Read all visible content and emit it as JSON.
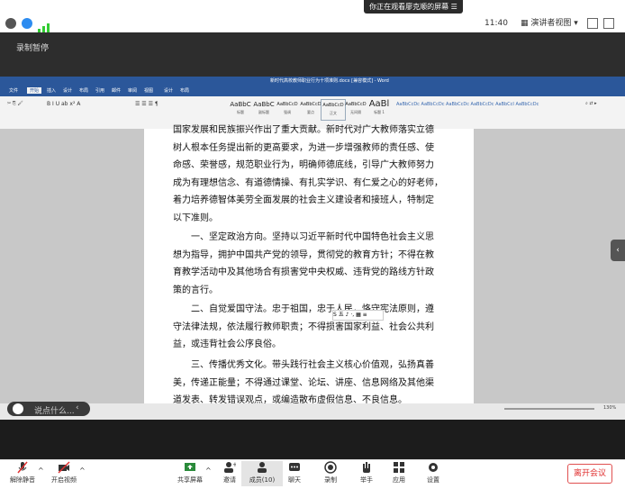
{
  "topbar": {
    "share_banner": "你正在观看廖克顺的屏幕",
    "time": "11:40",
    "view_label": "演讲者视图"
  },
  "recording": {
    "label": "录制暂停"
  },
  "word": {
    "title": "新时代高校教师职业行为十项准则.docx [兼容模式] - Word",
    "tabs": [
      "文件",
      "开始",
      "插入",
      "设计",
      "布局",
      "引用",
      "邮件",
      "审阅",
      "视图",
      "设计",
      "布局"
    ],
    "styles": [
      {
        "sample": "AaBbC",
        "name": "标题"
      },
      {
        "sample": "AaBbC",
        "name": "副标题"
      },
      {
        "sample": "AaBbCcD",
        "name": "强调"
      },
      {
        "sample": "AaBbCcD",
        "name": "要点"
      },
      {
        "sample": "AaBbCcD",
        "name": "正文"
      },
      {
        "sample": "AaBbCcD",
        "name": "无间隔"
      },
      {
        "sample": "AaBl",
        "name": "标题 1"
      }
    ],
    "zoom": "130%"
  },
  "document": {
    "p1": [
      "国家发展和民族振兴作出了重大贡献。新时代对广大教师落实立德",
      "树人根本任务提出新的更高要求，为进一步增强教师的责任感、使",
      "命感、荣誉感，规范职业行为，明确师德底线，引导广大教师努力",
      "成为有理想信念、有道德情操、有扎实学识、有仁爱之心的好老师，",
      "着力培养德智体美劳全面发展的社会主义建设者和接班人，特制定",
      "以下准则。"
    ],
    "p2": [
      "一、坚定政治方向。坚持以习近平新时代中国特色社会主义思",
      "想为指导，拥护中国共产党的领导，贯彻党的教育方针；不得在教",
      "育教学活动中及其他场合有损害党中央权威、违背党的路线方针政",
      "策的言行。"
    ],
    "p3": [
      "二、自觉爱国守法。忠于祖国，忠于人民，恪守宪法原则，遵",
      "守法律法规，依法履行教师职责；不得损害国家利益、社会公共利",
      "益，或违背社会公序良俗。"
    ],
    "p4": [
      "三、传播优秀文化。带头践行社会主义核心价值观，弘扬真善",
      "美，传递正能量；不得通过课堂、论坛、讲座、信息网络及其他渠",
      "道发表、转发错误观点，或编造散布虚假信息、不良信息。"
    ]
  },
  "chat": {
    "placeholder": "说点什么..."
  },
  "bottombar": {
    "items": [
      {
        "label": "解除静音",
        "icon": "mic-muted-icon"
      },
      {
        "label": "开启视频",
        "icon": "video-off-icon"
      },
      {
        "label": "共享屏幕",
        "icon": "share-screen-icon"
      },
      {
        "label": "邀请",
        "icon": "invite-icon"
      },
      {
        "label": "成员(10)",
        "icon": "members-icon"
      },
      {
        "label": "聊天",
        "icon": "chat-icon"
      },
      {
        "label": "录制",
        "icon": "record-icon"
      },
      {
        "label": "举手",
        "icon": "hand-icon"
      },
      {
        "label": "应用",
        "icon": "apps-icon"
      },
      {
        "label": "设置",
        "icon": "gear-icon"
      }
    ],
    "leave_label": "离开会议"
  },
  "colors": {
    "word_blue": "#2b579a",
    "leave_red": "#e03030"
  }
}
